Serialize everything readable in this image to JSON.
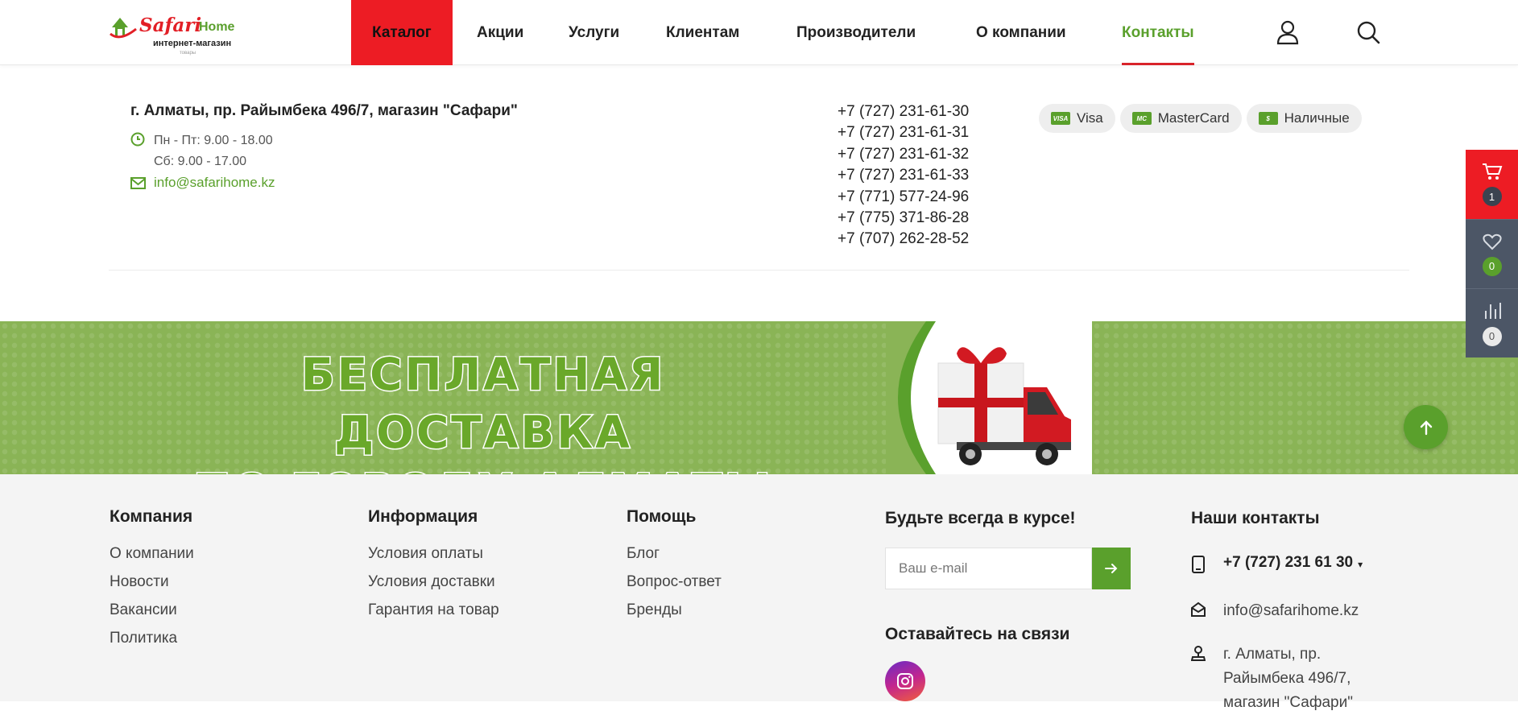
{
  "header": {
    "logo": {
      "brand": "Safari",
      "home": "Home",
      "subtitle": "интернет-магазин",
      "tiny": "товары"
    },
    "nav": [
      {
        "label": "Каталог"
      },
      {
        "label": "Акции"
      },
      {
        "label": "Услуги"
      },
      {
        "label": "Клиентам"
      },
      {
        "label": "Производители"
      },
      {
        "label": "О компании"
      },
      {
        "label": "Контакты"
      }
    ],
    "icons": [
      "user-icon",
      "search-icon"
    ]
  },
  "contact": {
    "address": "г. Алматы, пр. Райымбека 496/7, магазин \"Сафари\"",
    "hours_weekdays": "Пн - Пт: 9.00 - 18.00",
    "hours_saturday": "Сб: 9.00 - 17.00",
    "email": "info@safarihome.kz",
    "phones": [
      "+7 (727) 231-61-30",
      "+7 (727) 231-61-31",
      "+7 (727) 231-61-32",
      "+7 (727) 231-61-33",
      "+7 (771) 577-24-96",
      "+7 (775) 371-86-28",
      "+7 (707) 262-28-52"
    ],
    "payments": [
      {
        "icon_text": "VISA",
        "label": "Visa"
      },
      {
        "icon_text": "MC",
        "label": "MasterCard"
      },
      {
        "icon_text": "$",
        "label": "Наличные"
      }
    ]
  },
  "banner": {
    "line1": "БЕСПЛАТНАЯ ДОСТАВКА",
    "line2": "ПО ГОРОДУ АЛМАТЫ"
  },
  "footer": {
    "company": {
      "title": "Компания",
      "links": [
        "О компании",
        "Новости",
        "Вакансии",
        "Политика"
      ]
    },
    "info": {
      "title": "Информация",
      "links": [
        "Условия оплаты",
        "Условия доставки",
        "Гарантия на товар"
      ]
    },
    "help": {
      "title": "Помощь",
      "links": [
        "Блог",
        "Вопрос-ответ",
        "Бренды"
      ]
    },
    "subscribe": {
      "title": "Будьте всегда в курсе!",
      "placeholder": "Ваш e-mail",
      "social_title": "Оставайтесь на связи"
    },
    "contacts": {
      "title": "Наши контакты",
      "phone": "+7 (727) 231 61 30",
      "email": "info@safarihome.kz",
      "address_line1": "г. Алматы, пр.",
      "address_line2": "Райымбека 496/7,",
      "address_line3": "магазин \"Сафари\""
    }
  },
  "side": {
    "cart_count": "1",
    "favorites_count": "0",
    "compare_count": "0"
  },
  "colors": {
    "brand_red": "#ed1c24",
    "brand_green": "#5aa02c",
    "side_dark": "#4c5666",
    "footer_bg": "#f4f4f4"
  }
}
